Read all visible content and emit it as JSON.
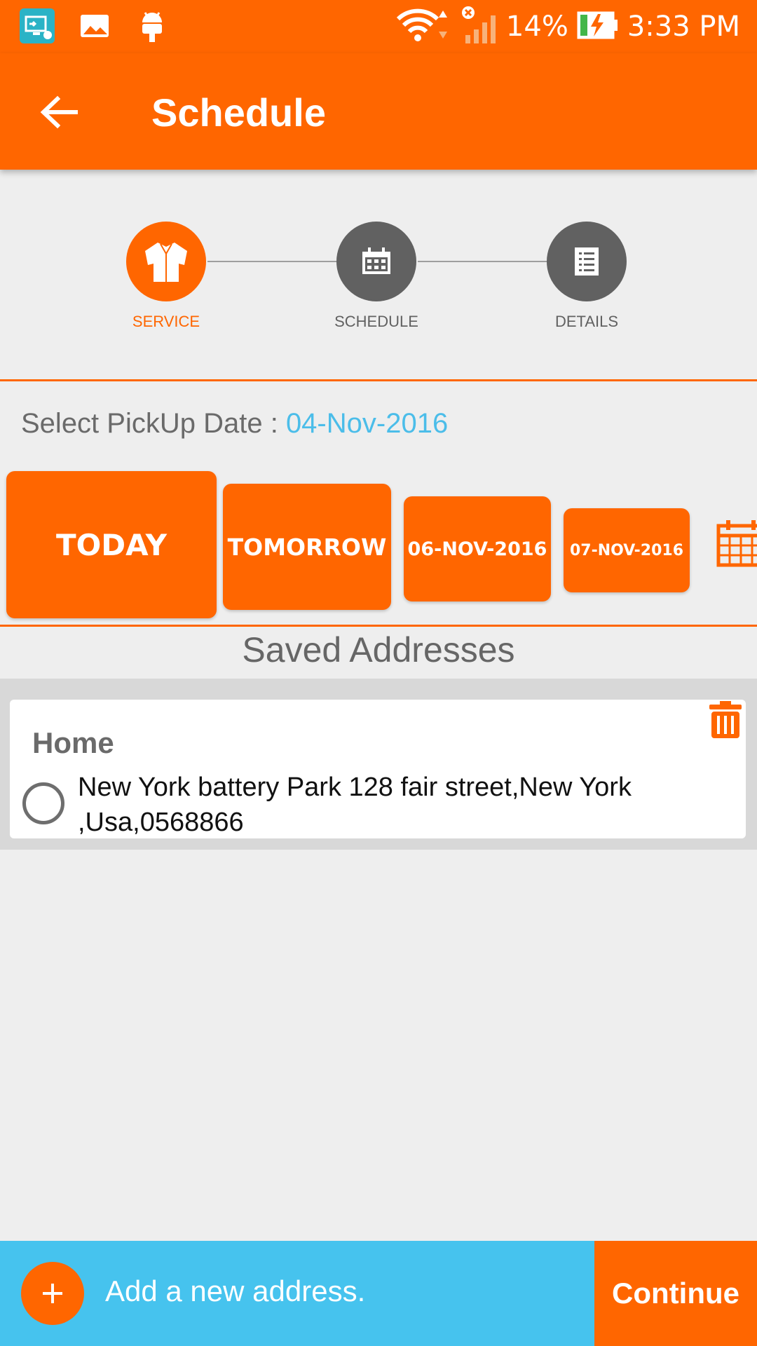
{
  "status_bar": {
    "wifi_icon": "wifi-icon",
    "signal_icon": "signal-icon",
    "battery_percent": "14%",
    "time": "3:33 PM"
  },
  "app_bar": {
    "title": "Schedule"
  },
  "stepper": {
    "steps": [
      {
        "label": "SERVICE",
        "icon": "shirt-icon",
        "active": true
      },
      {
        "label": "SCHEDULE",
        "icon": "calendar-icon",
        "active": false
      },
      {
        "label": "DETAILS",
        "icon": "list-icon",
        "active": false
      }
    ]
  },
  "pickup": {
    "label": "Select PickUp Date : ",
    "selected_date": "04-Nov-2016",
    "options": [
      "TODAY",
      "TOMORROW",
      "06-NOV-2016",
      "07-NOV-2016"
    ]
  },
  "saved": {
    "title": "Saved Addresses",
    "addresses": [
      {
        "name": "Home",
        "address": "New York battery Park 128 fair street,New York ,Usa,0568866"
      }
    ]
  },
  "bottom": {
    "add_label": "Add a new address.",
    "continue_label": "Continue"
  },
  "colors": {
    "accent": "#ff6600",
    "secondary": "#46c3ee",
    "date_text": "#4bbde9"
  }
}
